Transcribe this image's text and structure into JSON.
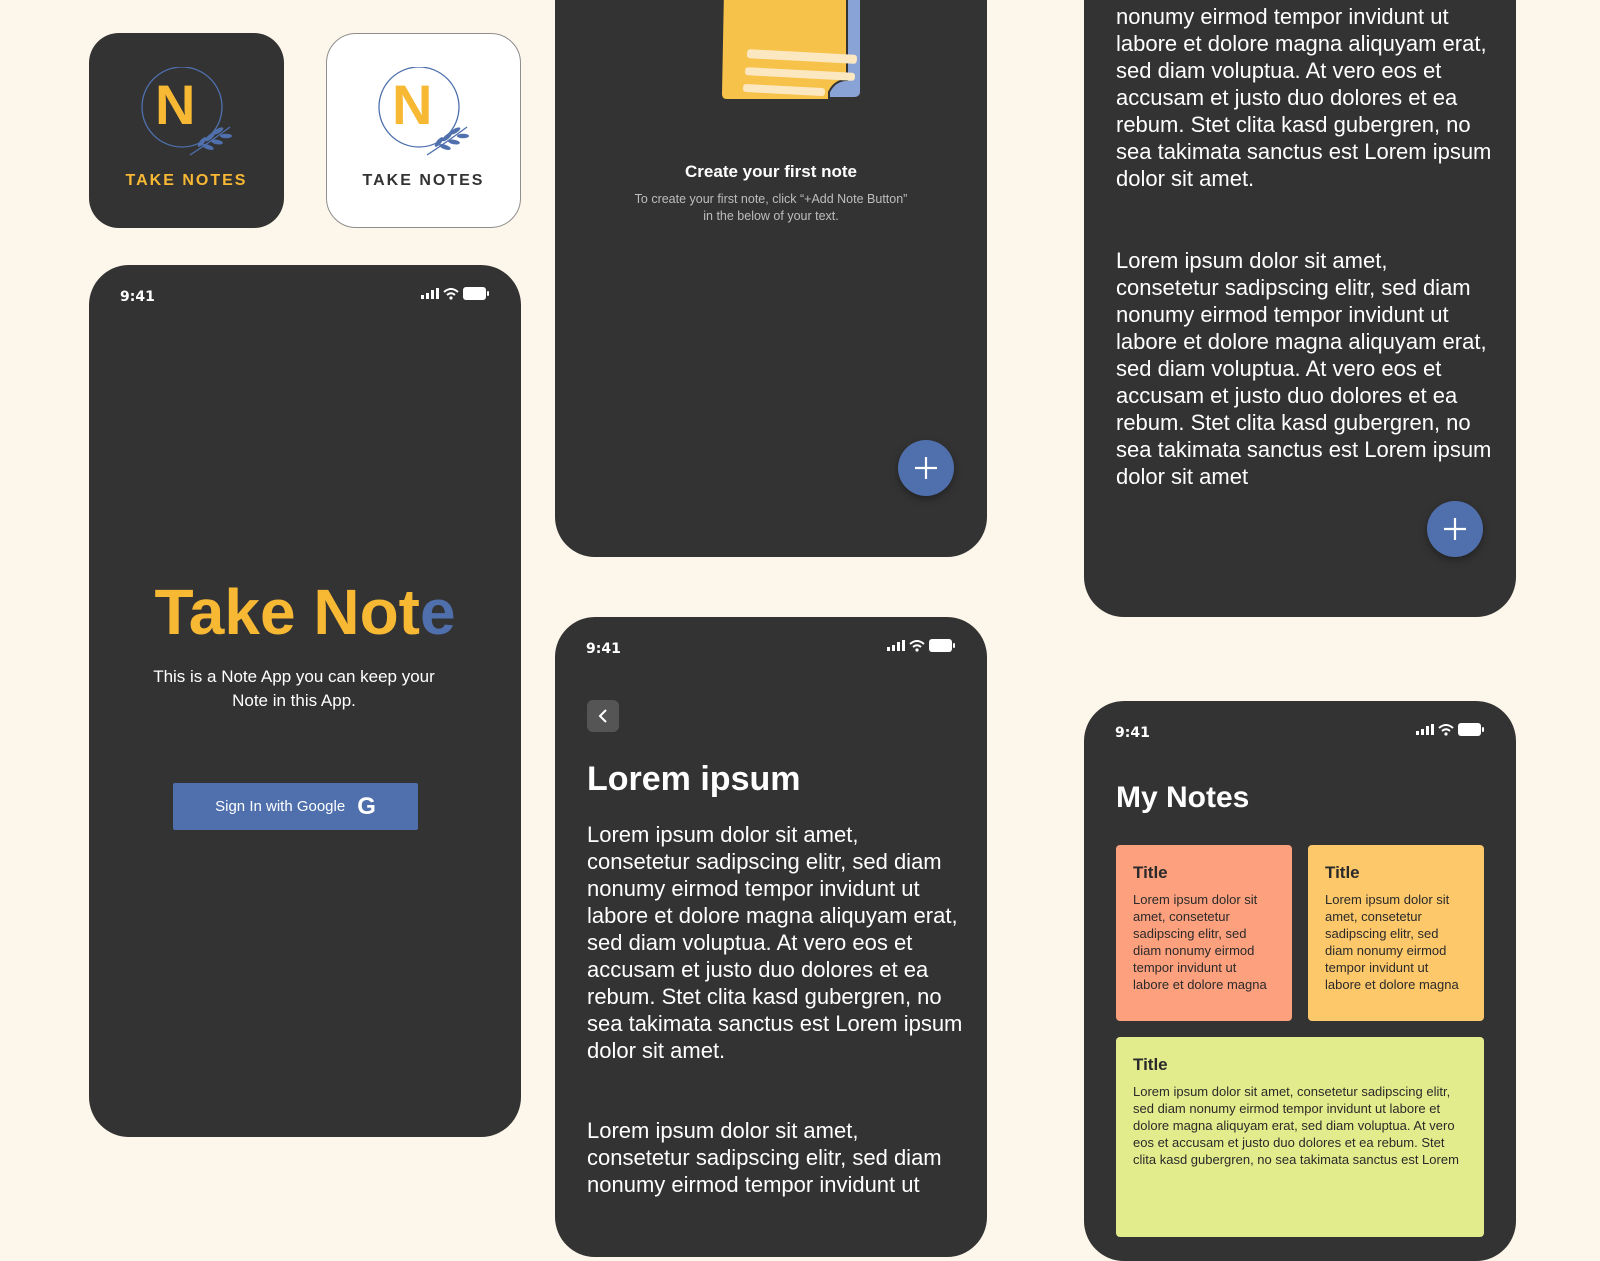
{
  "brand": {
    "logo_letter": "N",
    "icon_label": "TAKE NOTES",
    "colors": {
      "yellow": "#f7b834",
      "blue": "#4f70ad",
      "dark": "#333333",
      "cream": "#fdf6ea"
    }
  },
  "status_bar": {
    "time": "9:41"
  },
  "splash": {
    "title_part1": "Take ",
    "title_mark": "N",
    "title_part2": "ot",
    "title_part3": "e",
    "subtitle": "This is a Note App you can keep your Note in this App.",
    "signin_label": "Sign In with Google",
    "google_letter": "G"
  },
  "empty_state": {
    "heading": "Create your first note",
    "line1": "To create your first note, click “+Add Note Button”",
    "line2": "in the below of your text."
  },
  "note_detail": {
    "title": "Lorem ipsum",
    "paragraph1": "Lorem ipsum dolor sit amet,\nconsetetur sadipscing elitr, sed diam\nnonumy eirmod tempor invidunt ut\nlabore et dolore magna aliquyam erat,\nsed diam voluptua. At vero eos et\naccusam et justo duo dolores et ea\nrebum. Stet clita kasd gubergren, no\nsea takimata sanctus est Lorem ipsum\ndolor sit amet.",
    "paragraph2": "Lorem ipsum dolor sit amet,\nconsetetur sadipscing elitr, sed diam\nnonumy eirmod tempor invidunt ut"
  },
  "note_scrolled": {
    "partial_line": "nonumy eirmod tempor invidunt ut",
    "paragraph1_rest": "nonumy eirmod tempor invidunt ut\nlabore et dolore magna aliquyam erat,\nsed diam voluptua. At vero eos et\naccusam et justo duo dolores et ea\nrebum. Stet clita kasd gubergren, no\nsea takimata sanctus est Lorem ipsum\ndolor sit amet.",
    "paragraph2": "Lorem ipsum dolor sit amet,\nconsetetur sadipscing elitr, sed diam\nnonumy eirmod tempor invidunt ut\nlabore et dolore magna aliquyam erat,\nsed diam voluptua. At vero eos et\naccusam et justo duo dolores et ea\nrebum. Stet clita kasd gubergren, no\nsea takimata sanctus est Lorem ipsum\ndolor sit amet"
  },
  "my_notes": {
    "heading": "My Notes",
    "cards": [
      {
        "title": "Title",
        "body": "Lorem ipsum dolor sit amet, consetetur sadipscing elitr, sed diam nonumy eirmod tempor invidunt ut labore et dolore magna",
        "color": "#fda07e"
      },
      {
        "title": "Title",
        "body": "Lorem ipsum dolor sit amet, consetetur sadipscing elitr, sed diam nonumy eirmod tempor invidunt ut labore et dolore magna",
        "color": "#fdc86a"
      },
      {
        "title": "Title",
        "body": "Lorem ipsum dolor sit amet, consetetur sadipscing elitr, sed diam nonumy eirmod tempor invidunt ut labore et dolore magna aliquyam erat, sed diam voluptua. At vero eos et accusam et justo duo dolores et ea rebum. Stet clita kasd gubergren, no sea takimata sanctus est Lorem",
        "color": "#e3ec8c"
      }
    ]
  },
  "icons": {
    "signal": "signal-icon",
    "wifi": "wifi-icon",
    "battery": "battery-icon",
    "add": "plus-icon",
    "back": "chevron-left-icon",
    "notes": "notes-illustration",
    "laurel": "laurel-icon"
  }
}
